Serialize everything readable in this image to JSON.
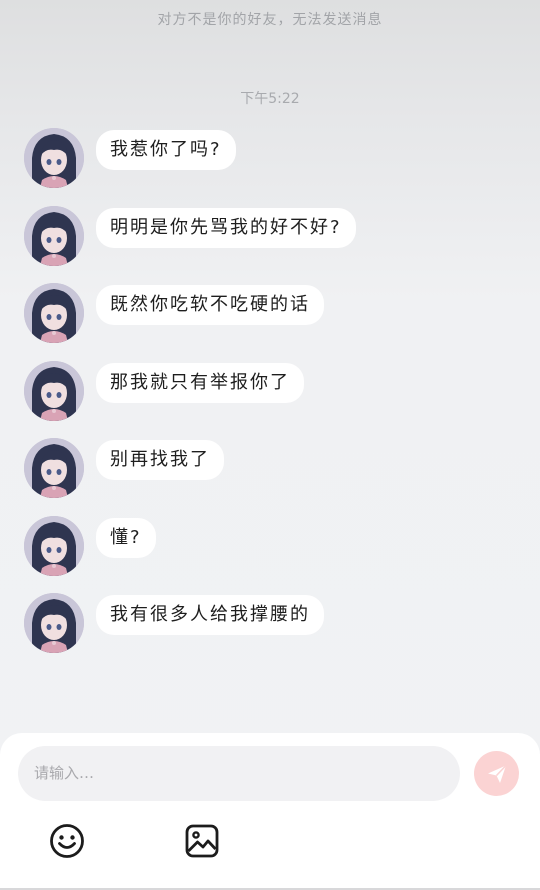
{
  "header": {
    "notice": "对方不是你的好友，无法发送消息"
  },
  "conversation": {
    "timestamp": "下午5:22",
    "messages": [
      {
        "text": "我惹你了吗?"
      },
      {
        "text": "明明是你先骂我的好不好?"
      },
      {
        "text": "既然你吃软不吃硬的话"
      },
      {
        "text": "那我就只有举报你了"
      },
      {
        "text": "别再找我了"
      },
      {
        "text": "懂?"
      },
      {
        "text": "我有很多人给我撑腰的"
      }
    ]
  },
  "composer": {
    "placeholder": "请输入…",
    "send_icon": "send-paper-plane-icon",
    "tools": [
      {
        "icon": "emoji-smiley-icon"
      },
      {
        "icon": "image-gallery-icon"
      }
    ]
  },
  "colors": {
    "bubble": "#ffffff",
    "send_button": "#fbd3d3",
    "input_background": "#f1f1f3"
  }
}
